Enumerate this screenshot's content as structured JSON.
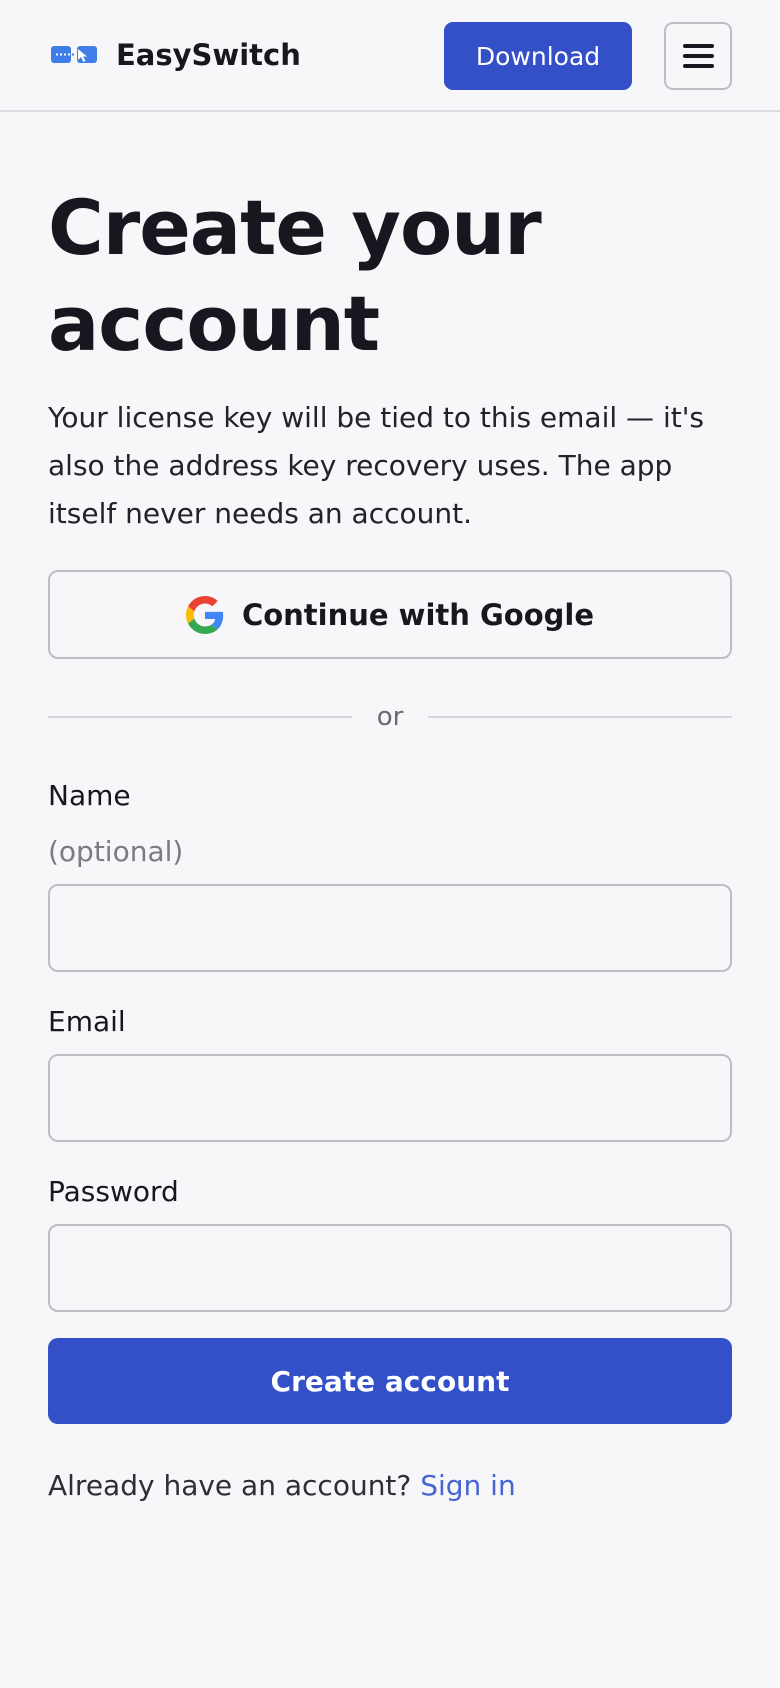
{
  "brand": {
    "name": "EasySwitch",
    "logo_icon": "switch-devices-icon",
    "accent_color": "#3350c8"
  },
  "header": {
    "download_label": "Download",
    "menu_icon": "hamburger-menu-icon"
  },
  "page": {
    "title": "Create your account",
    "description": "Your license key will be tied to this email — it's also the address key recovery uses. The app itself never needs an account."
  },
  "oauth": {
    "google_label": "Continue with Google",
    "google_icon": "google-icon"
  },
  "divider": {
    "text": "or"
  },
  "form": {
    "name": {
      "label": "Name",
      "hint": "(optional)",
      "value": ""
    },
    "email": {
      "label": "Email",
      "value": ""
    },
    "password": {
      "label": "Password",
      "value": ""
    },
    "submit_label": "Create account"
  },
  "footer": {
    "prompt": "Already have an account?",
    "link_label": "Sign in",
    "link_color": "#4766d1"
  }
}
